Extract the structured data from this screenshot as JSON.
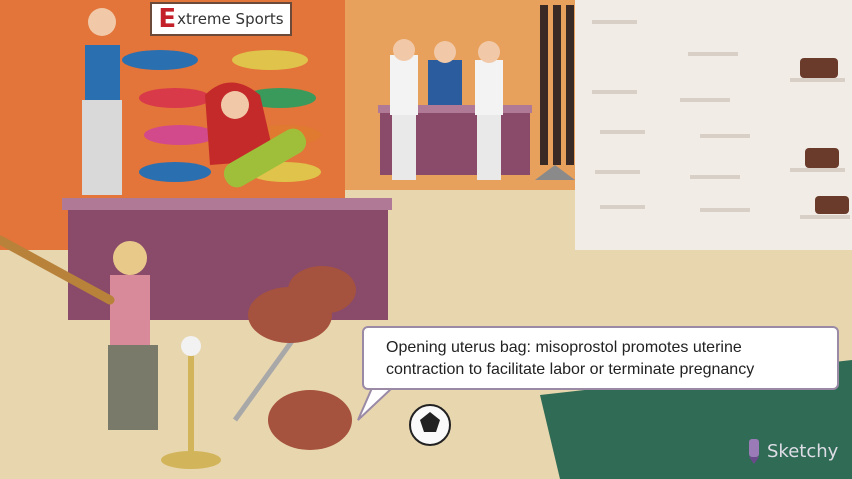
{
  "store_sign": {
    "initial": "E",
    "rest": "xtreme Sports"
  },
  "caption": {
    "line1": "Opening uterus bag: misoprostol promotes uterine",
    "line2": "contraction to facilitate labor or terminate pregnancy"
  },
  "brand": {
    "name": "Sketchy"
  },
  "colors": {
    "wall_orange": "#e3743a",
    "floor_beige": "#e8d6ae",
    "counter_purple": "#8a4a6a",
    "mat_green": "#2f6b55",
    "bubble_border": "#9a8aa6"
  }
}
